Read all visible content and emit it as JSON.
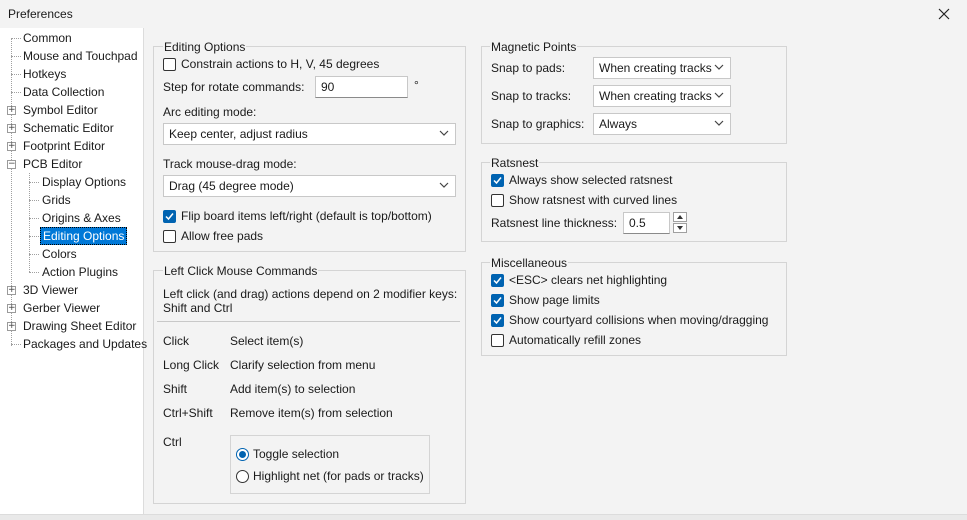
{
  "window": {
    "title": "Preferences"
  },
  "tree": {
    "items": [
      {
        "label": "Common"
      },
      {
        "label": "Mouse and Touchpad"
      },
      {
        "label": "Hotkeys"
      },
      {
        "label": "Data Collection"
      },
      {
        "label": "Symbol Editor"
      },
      {
        "label": "Schematic Editor"
      },
      {
        "label": "Footprint Editor"
      },
      {
        "label": "PCB Editor"
      },
      {
        "label": "Display Options"
      },
      {
        "label": "Grids"
      },
      {
        "label": "Origins & Axes"
      },
      {
        "label": "Editing Options"
      },
      {
        "label": "Colors"
      },
      {
        "label": "Action Plugins"
      },
      {
        "label": "3D Viewer"
      },
      {
        "label": "Gerber Viewer"
      },
      {
        "label": "Drawing Sheet Editor"
      },
      {
        "label": "Packages and Updates"
      }
    ],
    "selected": "Editing Options"
  },
  "editing": {
    "title": "Editing Options",
    "constrain_label": "Constrain actions to H, V, 45 degrees",
    "constrain_checked": false,
    "rotate_label": "Step for rotate commands:",
    "rotate_value": "90",
    "rotate_unit": "°",
    "arc_label": "Arc editing mode:",
    "arc_value": "Keep center, adjust radius",
    "drag_label": "Track mouse-drag mode:",
    "drag_value": "Drag (45 degree mode)",
    "flip_label": "Flip board items left/right (default is top/bottom)",
    "flip_checked": true,
    "freepads_label": "Allow free pads",
    "freepads_checked": false
  },
  "leftclick": {
    "title": "Left Click Mouse Commands",
    "desc_line1": "Left click (and drag) actions depend on 2 modifier keys:",
    "desc_line2": "Shift and Ctrl",
    "rows": [
      {
        "key": "Click",
        "action": "Select item(s)"
      },
      {
        "key": "Long Click",
        "action": "Clarify selection from menu"
      },
      {
        "key": "Shift",
        "action": "Add item(s) to selection"
      },
      {
        "key": "Ctrl+Shift",
        "action": "Remove item(s) from selection"
      }
    ],
    "ctrl_key": "Ctrl",
    "ctrl_options": [
      {
        "label": "Toggle selection",
        "checked": true
      },
      {
        "label": "Highlight net (for pads or tracks)",
        "checked": false
      }
    ]
  },
  "magnetic": {
    "title": "Magnetic Points",
    "rows": [
      {
        "label": "Snap to pads:",
        "value": "When creating tracks"
      },
      {
        "label": "Snap to tracks:",
        "value": "When creating tracks"
      },
      {
        "label": "Snap to graphics:",
        "value": "Always"
      }
    ]
  },
  "ratsnest": {
    "title": "Ratsnest",
    "always_label": "Always show selected ratsnest",
    "always_checked": true,
    "curved_label": "Show ratsnest with curved lines",
    "curved_checked": false,
    "thickness_label": "Ratsnest line thickness:",
    "thickness_value": "0.5"
  },
  "misc": {
    "title": "Miscellaneous",
    "items": [
      {
        "label": "<ESC> clears net highlighting",
        "checked": true
      },
      {
        "label": "Show page limits",
        "checked": true
      },
      {
        "label": "Show courtyard collisions when moving/dragging",
        "checked": true
      },
      {
        "label": "Automatically refill zones",
        "checked": false
      }
    ]
  },
  "colors": {
    "accent": "#0063b1",
    "selection": "#0078d7"
  }
}
